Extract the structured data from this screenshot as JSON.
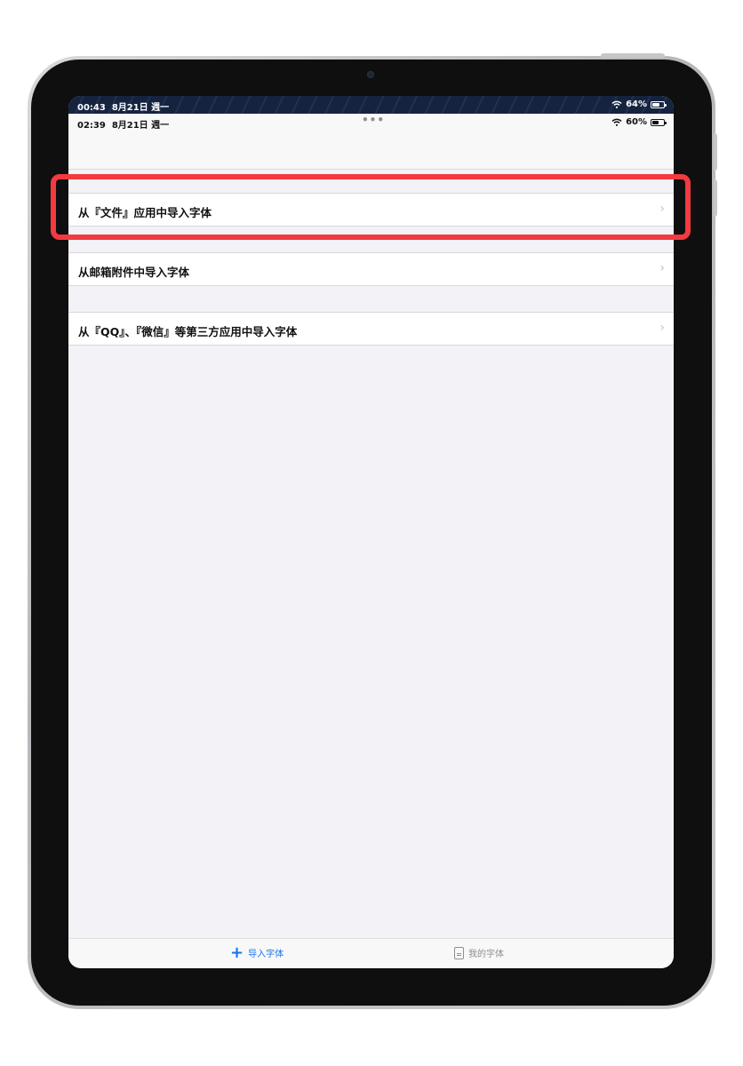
{
  "outer_status": {
    "time": "00:43",
    "date": "8月21日 週一",
    "battery": "64%",
    "battery_level": 0.64
  },
  "inner_status": {
    "time": "02:39",
    "date": "8月21日 週一",
    "dots": "•••",
    "battery": "60%",
    "battery_level": 0.6
  },
  "list": [
    {
      "label": "从『文件』应用中导入字体",
      "icon": "chevron-right-icon"
    },
    {
      "label": "从邮箱附件中导入字体",
      "icon": "chevron-right-icon"
    },
    {
      "label": "从『QQ』、『微信』等第三方应用中导入字体",
      "icon": "chevron-right-icon"
    }
  ],
  "tabbar": {
    "import": {
      "label": "导入字体",
      "icon": "plus-icon",
      "color": "#1a73e8"
    },
    "mine": {
      "label": "我的字体",
      "icon": "document-icon",
      "color": "#8e8e93"
    }
  },
  "highlight_color": "#f23a3f"
}
